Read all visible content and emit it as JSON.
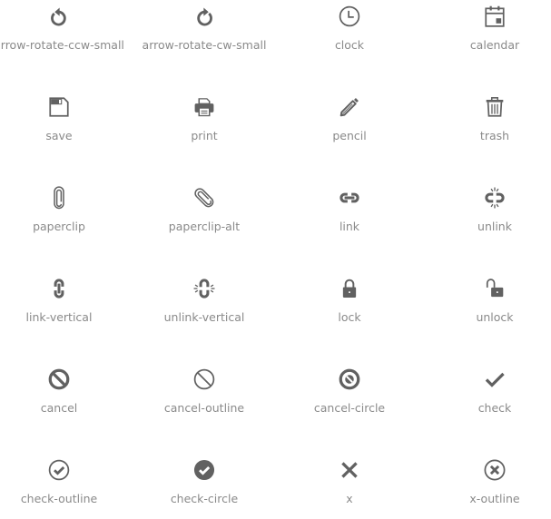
{
  "icon_color": "#616161",
  "label_color": "#8a8a8a",
  "icons": [
    {
      "name": "arrow-rotate-ccw-small",
      "label": "arrow-rotate-ccw-small"
    },
    {
      "name": "arrow-rotate-cw-small",
      "label": "arrow-rotate-cw-small"
    },
    {
      "name": "clock",
      "label": "clock"
    },
    {
      "name": "calendar",
      "label": "calendar"
    },
    {
      "name": "save",
      "label": "save"
    },
    {
      "name": "print",
      "label": "print"
    },
    {
      "name": "pencil",
      "label": "pencil"
    },
    {
      "name": "trash",
      "label": "trash"
    },
    {
      "name": "paperclip",
      "label": "paperclip"
    },
    {
      "name": "paperclip-alt",
      "label": "paperclip-alt"
    },
    {
      "name": "link",
      "label": "link"
    },
    {
      "name": "unlink",
      "label": "unlink"
    },
    {
      "name": "link-vertical",
      "label": "link-vertical"
    },
    {
      "name": "unlink-vertical",
      "label": "unlink-vertical"
    },
    {
      "name": "lock",
      "label": "lock"
    },
    {
      "name": "unlock",
      "label": "unlock"
    },
    {
      "name": "cancel",
      "label": "cancel"
    },
    {
      "name": "cancel-outline",
      "label": "cancel-outline"
    },
    {
      "name": "cancel-circle",
      "label": "cancel-circle"
    },
    {
      "name": "check",
      "label": "check"
    },
    {
      "name": "check-outline",
      "label": "check-outline"
    },
    {
      "name": "check-circle",
      "label": "check-circle"
    },
    {
      "name": "x",
      "label": "x"
    },
    {
      "name": "x-outline",
      "label": "x-outline"
    }
  ]
}
